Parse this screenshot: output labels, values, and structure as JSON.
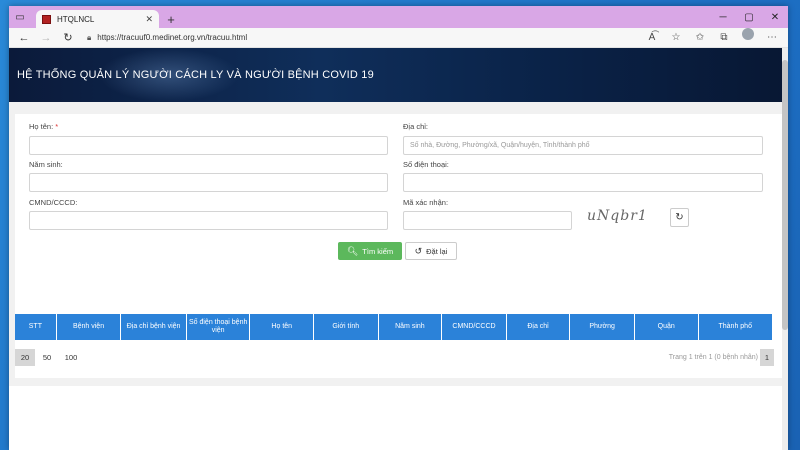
{
  "browser": {
    "tab_title": "HTQLNCL",
    "url": "https://tracuuf0.medinet.org.vn/tracuu.html",
    "new_tab_symbol": "+",
    "tab_close_symbol": "✕"
  },
  "banner": {
    "title": "HỆ THỐNG QUẢN LÝ NGƯỜI CÁCH LY VÀ NGƯỜI BỆNH COVID 19"
  },
  "form": {
    "name_label": "Họ tên:",
    "required_mark": "*",
    "address_label": "Địa chỉ:",
    "address_placeholder": "Số nhà, Đường, Phường/xã, Quận/huyện, Tỉnh/thành phố",
    "birthyear_label": "Năm sinh:",
    "phone_label": "Số điện thoại:",
    "idcard_label": "CMND/CCCD:",
    "captcha_label": "Mã xác nhận:",
    "captcha_text": "uNqbr1",
    "search_button": "Tìm kiếm",
    "reset_button": "Đặt lại"
  },
  "table": {
    "columns": [
      "STT",
      "Bệnh viện",
      "Địa chỉ bệnh viện",
      "Số điện thoại bệnh viện",
      "Họ tên",
      "Giới tính",
      "Năm sinh",
      "CMND/CCCD",
      "Địa chỉ",
      "Phường",
      "Quận",
      "Thành phố"
    ],
    "page_sizes": [
      "20",
      "50",
      "100"
    ],
    "active_page_size": "20",
    "page_info": "Trang 1 trên 1 (0 bệnh nhân)",
    "current_page": "1"
  },
  "icons": {
    "menu": "tab-actions-icon",
    "back": "back-arrow-icon",
    "forward": "forward-arrow-icon",
    "reload": "reload-icon",
    "lock": "lock-icon",
    "search": "search-icon",
    "reset": "undo-icon",
    "refresh": "refresh-icon"
  },
  "colors": {
    "accent": "#2b82d9",
    "search_button": "#5cb85c",
    "tabstrip": "#d9a7e6",
    "banner": "#0f2e5a"
  }
}
